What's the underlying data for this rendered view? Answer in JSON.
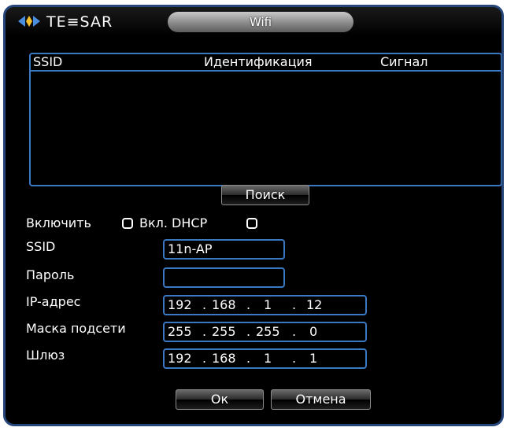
{
  "window": {
    "title": "Wifi",
    "logo_text": "TE≡SAR"
  },
  "list": {
    "columns": [
      "SSID",
      "Идентификация",
      "Сигнал"
    ]
  },
  "search_button": "Поиск",
  "enable": {
    "label": "Включить",
    "checked": false
  },
  "dhcp": {
    "label": "Вкл. DHCP",
    "checked": false
  },
  "form": {
    "ssid_label": "SSID",
    "ssid_value": "11n-AP",
    "password_label": "Пароль",
    "password_value": "",
    "ip_label": "IP-адрес",
    "ip": [
      "192",
      "168",
      "1",
      "12"
    ],
    "mask_label": "Маска подсети",
    "mask": [
      "255",
      "255",
      "255",
      "0"
    ],
    "gateway_label": "Шлюз",
    "gateway": [
      "192",
      "168",
      "1",
      "1"
    ]
  },
  "ok_button": "Ок",
  "cancel_button": "Отмена",
  "colors": {
    "border": "#3a78c2",
    "background": "#000000",
    "text": "#ffffff"
  }
}
